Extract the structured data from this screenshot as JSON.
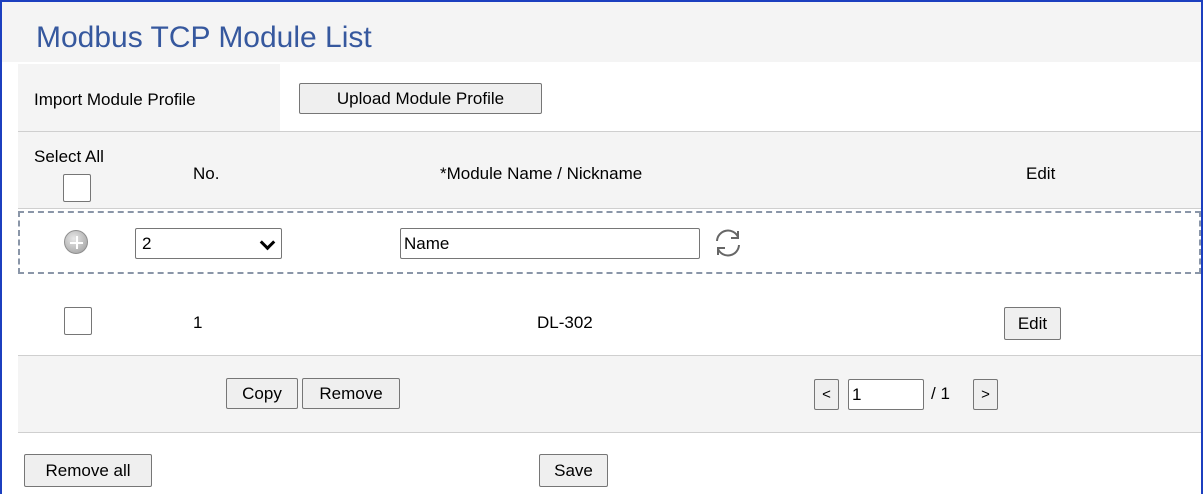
{
  "title": "Modbus TCP Module List",
  "import": {
    "label": "Import Module Profile",
    "upload_button": "Upload Module Profile"
  },
  "table": {
    "headers": {
      "select_all": "Select All",
      "no": "No.",
      "name": "*Module Name / Nickname",
      "edit": "Edit"
    },
    "add_row": {
      "number_selected": "2",
      "name_value": "Name"
    },
    "rows": [
      {
        "no": "1",
        "name": "DL-302",
        "edit_label": "Edit"
      }
    ]
  },
  "actions": {
    "copy": "Copy",
    "remove": "Remove"
  },
  "pagination": {
    "prev": "<",
    "current_page": "1",
    "total": "/ 1",
    "next": ">"
  },
  "bottom": {
    "remove_all": "Remove all",
    "save": "Save"
  },
  "colors": {
    "title": "#36589e",
    "frame": "#1c3fbf",
    "dashed_border": "#8a96a8"
  }
}
